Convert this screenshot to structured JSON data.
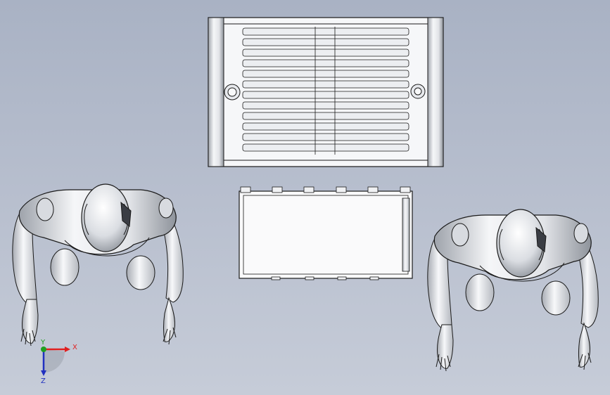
{
  "viewport": {
    "view": "top",
    "objects": [
      "crate-rack-top",
      "crate-box-top",
      "humanoid-robot-left",
      "humanoid-robot-right"
    ]
  },
  "triad": {
    "x_label": "X",
    "y_label": "Y",
    "z_label": "Z",
    "x_color": "#e02020",
    "y_color": "#1fa01f",
    "z_color": "#2030c0"
  },
  "colors": {
    "background_top": "#a9b2c4",
    "background_bottom": "#c6ccd8",
    "model_fill": "#f4f5f7",
    "model_shade": "#c9ccd2",
    "edge": "#1a1a1a"
  }
}
